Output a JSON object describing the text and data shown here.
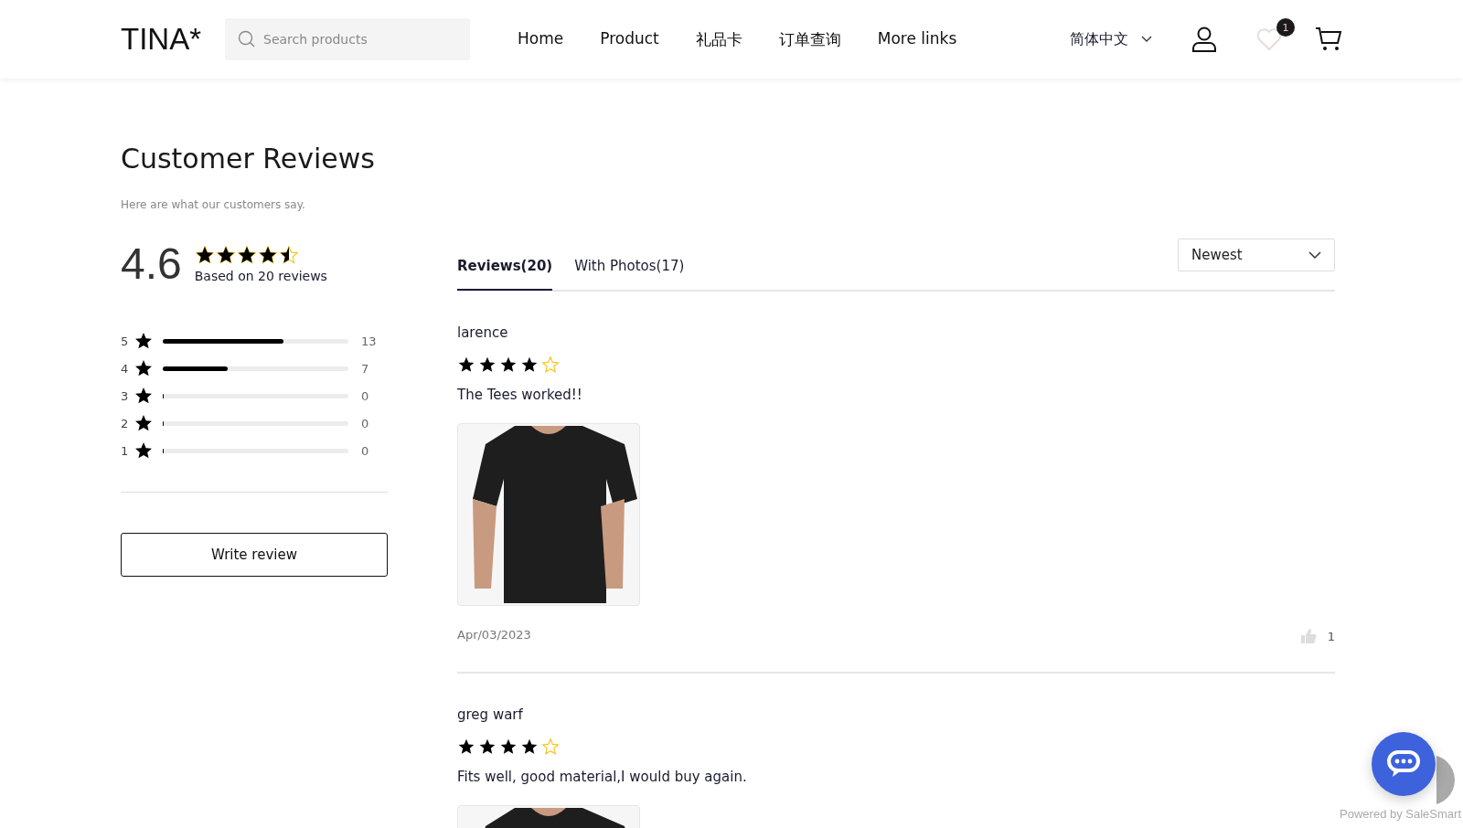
{
  "header": {
    "logo": "TINA*",
    "search": {
      "placeholder": "Search products"
    },
    "nav": [
      {
        "label": "Home"
      },
      {
        "label": "Product"
      },
      {
        "label": "礼品卡"
      },
      {
        "label": "订单查询"
      },
      {
        "label": "More links"
      }
    ],
    "language": "简体中文",
    "wishlist_count": "1"
  },
  "reviews_section": {
    "title": "Customer Reviews",
    "subtitle": "Here are what our customers say.",
    "summary": {
      "score": "4.6",
      "stars": 4.5,
      "based_on": "Based on 20 reviews"
    },
    "distribution": [
      {
        "rating": "5",
        "level": 0.65,
        "count": "13"
      },
      {
        "rating": "4",
        "level": 0.35,
        "count": "7"
      },
      {
        "rating": "3",
        "level": 0,
        "count": "0"
      },
      {
        "rating": "2",
        "level": 0,
        "count": "0"
      },
      {
        "rating": "1",
        "level": 0,
        "count": "0"
      }
    ],
    "write_button": "Write review",
    "tabs": [
      {
        "label": "Reviews(20)",
        "selected": true
      },
      {
        "label": "With Photos(17)",
        "selected": false
      }
    ],
    "sort": "Newest",
    "reviews": [
      {
        "author": "larence",
        "stars": 4,
        "text": "The Tees worked!!",
        "has_photo": true,
        "date": "Apr/03/2023",
        "likes": "1"
      },
      {
        "author": "greg warf",
        "stars": 4,
        "text": "Fits well, good material,I would buy again.",
        "has_photo": true
      }
    ]
  },
  "footer_note": "Powered by SaleSmart"
}
